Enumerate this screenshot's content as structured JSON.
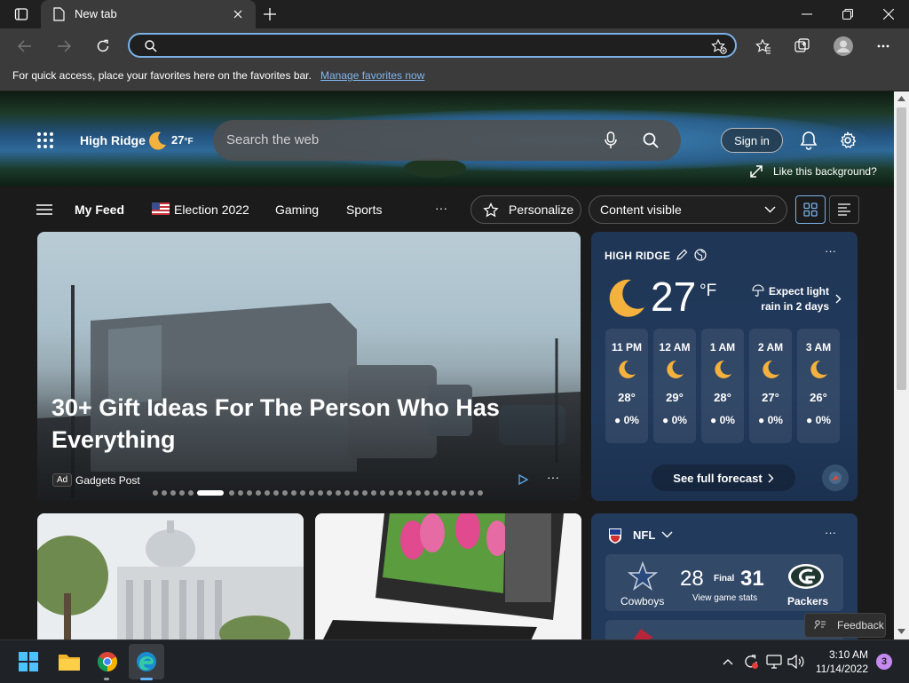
{
  "browser": {
    "tab_title": "New tab",
    "favorites_bar_text": "For quick access, place your favorites here on the favorites bar.",
    "favorites_link": "Manage favorites now",
    "address_value": ""
  },
  "newtab": {
    "location": "High Ridge",
    "temp": "27",
    "unit": "°F",
    "search_placeholder": "Search the web",
    "sign_in": "Sign in",
    "like_background": "Like this background?"
  },
  "nav": {
    "my_feed": "My Feed",
    "election": "Election 2022",
    "gaming": "Gaming",
    "sports": "Sports",
    "more": "···",
    "personalize": "Personalize",
    "content_visible": "Content visible"
  },
  "hero_card": {
    "headline": "30+ Gift Ideas For The Person Who Has Everything",
    "ad_badge": "Ad",
    "source": "Gadgets Post",
    "more": "···",
    "slide_count": 35,
    "active_slide": 5
  },
  "weather": {
    "location": "HIGH RIDGE",
    "temp": "27",
    "unit": "°F",
    "forecast_line1": "Expect light",
    "forecast_line2": "rain in 2 days",
    "more": "···",
    "hours": [
      {
        "time": "11 PM",
        "temp": "28°",
        "precip": "0%"
      },
      {
        "time": "12 AM",
        "temp": "29°",
        "precip": "0%"
      },
      {
        "time": "1 AM",
        "temp": "28°",
        "precip": "0%"
      },
      {
        "time": "2 AM",
        "temp": "27°",
        "precip": "0%"
      },
      {
        "time": "3 AM",
        "temp": "26°",
        "precip": "0%"
      }
    ],
    "full_forecast": "See full forecast"
  },
  "nfl": {
    "league": "NFL",
    "more": "···",
    "team1": "Cowboys",
    "score1": "28",
    "status": "Final",
    "stats_link": "View game stats",
    "score2": "31",
    "team2": "Packers"
  },
  "feedback": "Feedback",
  "taskbar": {
    "time": "3:10 AM",
    "date": "11/14/2022",
    "notifications": "3"
  },
  "colors": {
    "accent": "#7ab2e8",
    "panel_blue": "#223a5c",
    "moon": "#f5b13d"
  }
}
